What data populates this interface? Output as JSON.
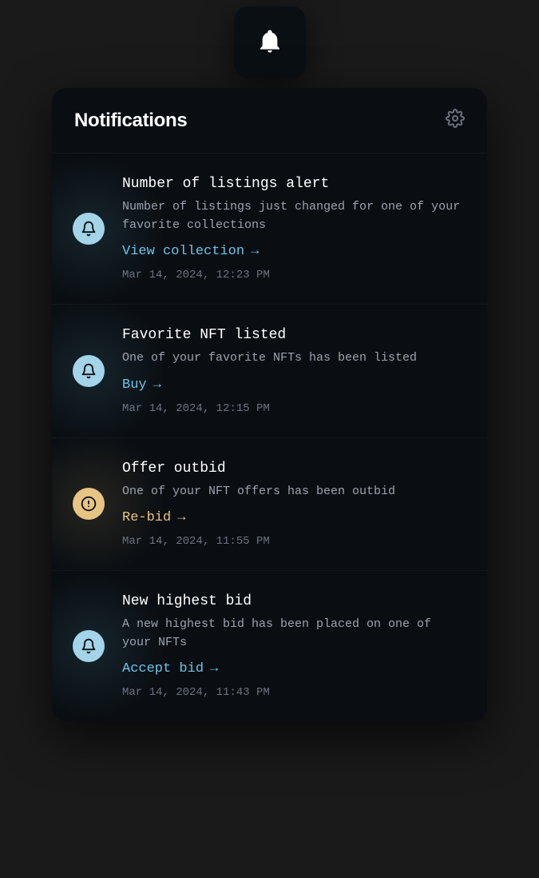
{
  "header": {
    "title": "Notifications"
  },
  "notifications": [
    {
      "icon": "bell",
      "iconColor": "blue",
      "title": "Number of listings alert",
      "description": "Number of listings just changed for one of your favorite collections",
      "action": "View collection",
      "actionColor": "blue",
      "timestamp": "Mar 14, 2024, 12:23 PM"
    },
    {
      "icon": "bell",
      "iconColor": "blue",
      "title": "Favorite NFT listed",
      "description": "One of your favorite NFTs has been listed",
      "action": "Buy",
      "actionColor": "blue",
      "timestamp": "Mar 14, 2024, 12:15 PM"
    },
    {
      "icon": "alert",
      "iconColor": "yellow",
      "title": "Offer outbid",
      "description": "One of your NFT offers has been outbid",
      "action": "Re-bid",
      "actionColor": "yellow",
      "timestamp": "Mar 14, 2024, 11:55 PM"
    },
    {
      "icon": "bell",
      "iconColor": "blue",
      "title": "New highest bid",
      "description": "A new highest bid has been placed on one of your NFTs",
      "action": "Accept bid",
      "actionColor": "blue",
      "timestamp": "Mar 14, 2024, 11:43 PM"
    }
  ]
}
